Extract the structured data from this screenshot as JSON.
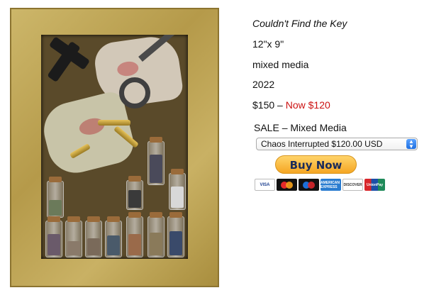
{
  "artwork": {
    "title": "Couldn't Find the Key",
    "size": "12\"x 9\"",
    "medium": "mixed media",
    "year": "2022",
    "original_price": "$150",
    "price_separator": " – ",
    "sale_price": "Now $120"
  },
  "purchase": {
    "sale_label": "SALE – Mixed Media",
    "selected_option": "Chaos Interrupted $120.00 USD",
    "buy_button_label": "Buy Now"
  },
  "payment_cards": [
    {
      "label": "VISA",
      "icon": "visa-icon"
    },
    {
      "label": "",
      "icon": "mastercard-icon"
    },
    {
      "label": "",
      "icon": "maestro-icon"
    },
    {
      "label": "AMERICAN EXPRESS",
      "icon": "amex-icon"
    },
    {
      "label": "DISCOVER",
      "icon": "discover-icon"
    },
    {
      "label": "UnionPay",
      "icon": "unionpay-icon"
    }
  ],
  "colors": {
    "sale_price": "#cc1111",
    "buy_button": "#f5a623",
    "select_arrow": "#1f6fe0"
  }
}
